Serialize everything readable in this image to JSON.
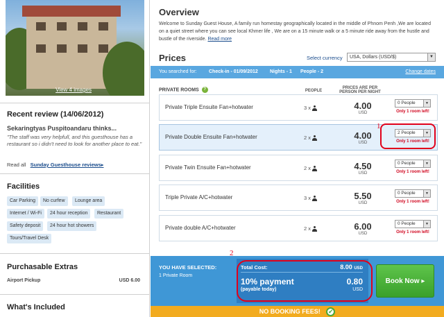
{
  "hotel": {
    "photo_link": "View 4 images"
  },
  "review": {
    "heading": "Recent review (14/06/2012)",
    "author": "Sekaringtyas Puspitoandaru thinks...",
    "quote": "\"The staff was very helpfull, and this guesthouse has a restaurant so i didn't need to look for another place to eat.\"",
    "read_all_label": "Read all",
    "read_all_link": "Sunday Guesthouse reviews▸"
  },
  "facilities": {
    "heading": "Facilities",
    "tags": [
      "Car Parking",
      "No curfew",
      "Lounge area",
      "Internet / Wi-Fi",
      "24 hour reception",
      "Restaurant",
      "Safety deposit",
      "24 hour hot showers",
      "Tours/Travel Desk"
    ]
  },
  "extras": {
    "heading": "Purchasable Extras",
    "items": [
      {
        "name": "Airport Pickup",
        "price": "USD 6.00"
      }
    ]
  },
  "included": {
    "heading": "What's Included"
  },
  "overview": {
    "title": "Overview",
    "text": "Welcome to Sunday Guest House, A family run homestay geographically located in the middle of Phnom Penh ,We are located on a quiet street where you can see local Khmer life , We are on a 15 minute walk or a 5 minute ride away from the hustle and bustle of the riverside.",
    "read_more": "Read more"
  },
  "prices": {
    "title": "Prices",
    "currency_label": "Select currency",
    "currency_value": "USA, Dollars (USD/$)"
  },
  "search": {
    "searched_for": "You searched for:",
    "checkin": "Check-in - 01/09/2012",
    "nights": "Nights - 1",
    "people": "People - 2",
    "change_dates": "Change dates"
  },
  "table": {
    "section_label": "PRIVATE ROOMS",
    "col_people": "PEOPLE",
    "col_price_line1": "PRICES ARE PER",
    "col_price_line2": "PERSON PER NIGHT",
    "rooms": [
      {
        "name": "Private Triple Ensuite Fan+hotwater",
        "people": "3 x",
        "price": "4.00",
        "unit": "USD",
        "select": "0 People",
        "note": "Only 1 room left!"
      },
      {
        "name": "Private Double Ensuite Fan+hotwater",
        "people": "2 x",
        "price": "4.00",
        "unit": "USD",
        "select": "2 People",
        "note": "Only 1 room left!"
      },
      {
        "name": "Private Twin Ensuite Fan+hotwater",
        "people": "2 x",
        "price": "4.50",
        "unit": "USD",
        "select": "0 People",
        "note": "Only 1 room left!"
      },
      {
        "name": "Triple Private A/C+hotwater",
        "people": "3 x",
        "price": "5.50",
        "unit": "USD",
        "select": "0 People",
        "note": "Only 1 room left!"
      },
      {
        "name": "Private double A/C+hotwater",
        "people": "2 x",
        "price": "6.00",
        "unit": "USD",
        "select": "0 People",
        "note": "Only 1 room left!"
      }
    ]
  },
  "annotations": [
    "1",
    "2"
  ],
  "booking": {
    "you_selected": "YOU HAVE SELECTED:",
    "selected_count": "1 Private Room",
    "total_label": "Total Cost:",
    "total_value": "8.00",
    "total_unit": "USD",
    "payment_title": "10% payment",
    "payment_sub": "(payable today)",
    "payment_value": "0.80",
    "payment_unit": "USD",
    "book_button": "Book Now ▸",
    "no_fees": "NO BOOKING FEES!",
    "check_glyph": "✔"
  },
  "colors": {
    "accent_blue": "#59a7e0",
    "book_green": "#3aa02b",
    "fees_orange": "#f2ab1f",
    "alert_red": "#d0021b",
    "annotation_red": "#e1001a"
  }
}
